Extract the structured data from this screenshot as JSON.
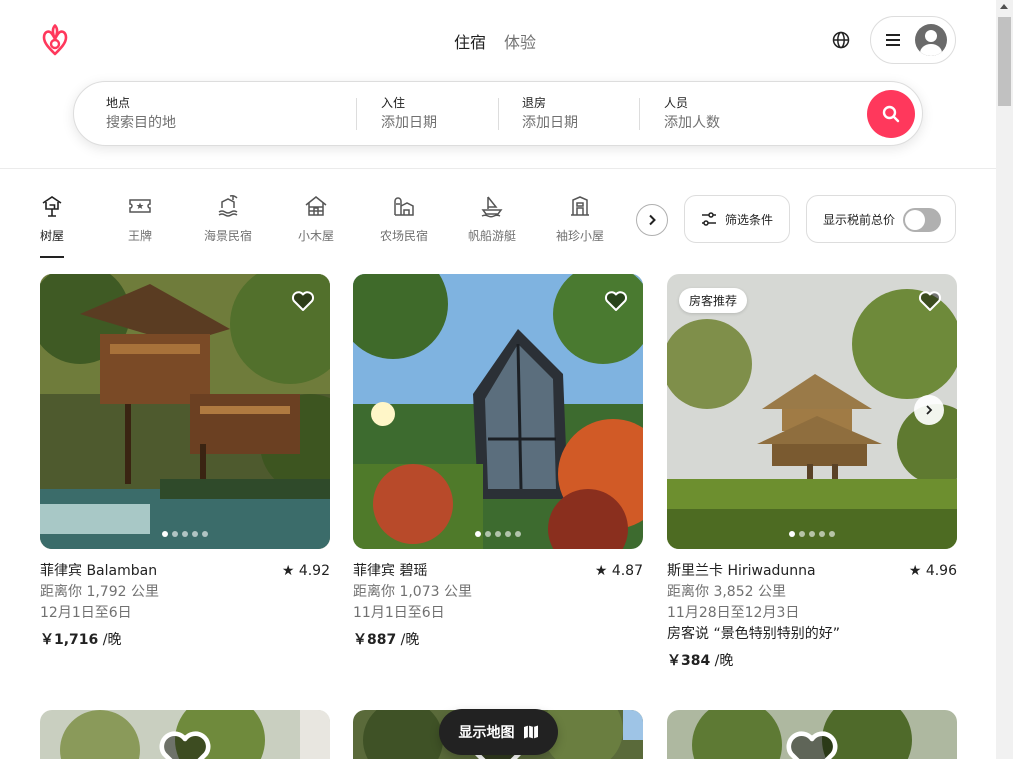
{
  "header": {
    "tabs": [
      {
        "label": "住宿"
      },
      {
        "label": "体验"
      }
    ]
  },
  "search": {
    "where": {
      "label": "地点",
      "placeholder": "搜索目的地"
    },
    "checkin": {
      "label": "入住",
      "placeholder": "添加日期"
    },
    "checkout": {
      "label": "退房",
      "placeholder": "添加日期"
    },
    "guests": {
      "label": "人员",
      "placeholder": "添加人数"
    }
  },
  "categories": [
    {
      "label": "树屋",
      "icon": "treehouse-icon",
      "active": true
    },
    {
      "label": "王牌",
      "icon": "ticket-icon"
    },
    {
      "label": "海景民宿",
      "icon": "beach-icon"
    },
    {
      "label": "小木屋",
      "icon": "cabin-icon"
    },
    {
      "label": "农场民宿",
      "icon": "farm-icon"
    },
    {
      "label": "帆船游艇",
      "icon": "boat-icon"
    },
    {
      "label": "袖珍小屋",
      "icon": "tiny-home-icon"
    }
  ],
  "filters": {
    "label": "筛选条件"
  },
  "tax_toggle": {
    "label": "显示税前总价",
    "on": false
  },
  "listings": [
    {
      "title": "菲律宾 Balamban",
      "rating": "★ 4.92",
      "distance": "距离你 1,792 公里",
      "dates": "12月1日至6日",
      "price": "￥1,716",
      "price_unit": " /晚",
      "photos": 5,
      "current_photo": 1
    },
    {
      "title": "菲律宾 碧瑶",
      "rating": "★ 4.87",
      "distance": "距离你 1,073 公里",
      "dates": "11月1日至6日",
      "price": "￥887",
      "price_unit": " /晚",
      "photos": 5,
      "current_photo": 1
    },
    {
      "title": "斯里兰卡 Hiriwadunna",
      "rating": "★ 4.96",
      "distance": "距离你 3,852 公里",
      "dates": "11月28日至12月3日",
      "review": "房客说 “景色特别特别的好”",
      "badge": "房客推荐",
      "price": "￥384",
      "price_unit": " /晚",
      "photos": 5,
      "current_photo": 1
    }
  ],
  "map_button": {
    "label": "显示地图"
  },
  "colors": {
    "brand": "#ff385c",
    "text": "#222222",
    "muted": "#717171",
    "border": "#dddddd"
  }
}
